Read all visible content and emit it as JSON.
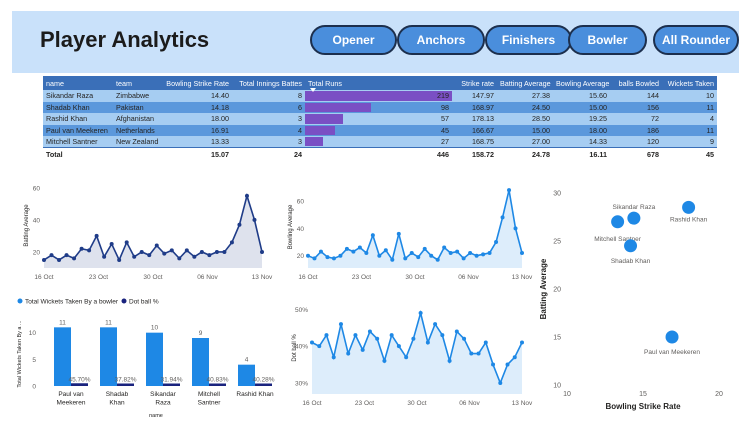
{
  "header": {
    "title": "Player Analytics",
    "buttons": [
      "Opener",
      "Anchors",
      "Finishers",
      "Bowler",
      "All Rounder"
    ]
  },
  "table": {
    "columns": [
      "name",
      "team",
      "Bowling Strike Rate",
      "Total Innings Battes",
      "Total Runs",
      "Strike rate",
      "Batting Average",
      "Bowling Average",
      "balls Bowled",
      "Wickets Taken"
    ],
    "rows": [
      [
        "Sikandar Raza",
        "Zimbabwe",
        "14.40",
        "8",
        "219",
        "147.97",
        "27.38",
        "15.60",
        "144",
        "10"
      ],
      [
        "Shadab Khan",
        "Pakistan",
        "14.18",
        "6",
        "98",
        "168.97",
        "24.50",
        "15.00",
        "156",
        "11"
      ],
      [
        "Rashid Khan",
        "Afghanistan",
        "18.00",
        "3",
        "57",
        "178.13",
        "28.50",
        "19.25",
        "72",
        "4"
      ],
      [
        "Paul van Meekeren",
        "Netherlands",
        "16.91",
        "4",
        "45",
        "166.67",
        "15.00",
        "18.00",
        "186",
        "11"
      ],
      [
        "Mitchell Santner",
        "New Zealand",
        "13.33",
        "3",
        "27",
        "168.75",
        "27.00",
        "14.33",
        "120",
        "9"
      ]
    ],
    "total": [
      "Total",
      "",
      "15.07",
      "24",
      "446",
      "158.72",
      "24.78",
      "16.11",
      "678",
      "45"
    ],
    "bar_color": "#7a4fc4"
  },
  "chart_data": [
    {
      "type": "area",
      "ylabel": "Batting Average",
      "xticks": [
        "16 Oct",
        "23 Oct",
        "30 Oct",
        "06 Nov",
        "13 Nov"
      ],
      "yticks": [
        "20",
        "40",
        "60"
      ],
      "ylim": [
        10,
        63
      ],
      "color": "#1f3c88",
      "values": [
        15,
        18,
        15,
        18,
        16,
        22,
        21,
        30,
        17,
        25,
        15,
        26,
        17,
        20,
        18,
        24,
        19,
        21,
        16,
        21,
        17,
        20,
        18,
        20,
        20,
        26,
        37,
        55,
        40,
        20
      ]
    },
    {
      "type": "area",
      "ylabel": "Bowling Average",
      "xticks": [
        "16 Oct",
        "23 Oct",
        "30 Oct",
        "06 Nov",
        "13 Nov"
      ],
      "yticks": [
        "20",
        "40",
        "60"
      ],
      "ylim": [
        11,
        71
      ],
      "color": "#1e88e5",
      "values": [
        20,
        18,
        23,
        19,
        18,
        20,
        25,
        23,
        26,
        22,
        35,
        20,
        24,
        17,
        36,
        18,
        22,
        19,
        25,
        20,
        17,
        26,
        22,
        23,
        18,
        22,
        20,
        21,
        22,
        30,
        48,
        68,
        40,
        22
      ]
    },
    {
      "type": "bar",
      "legend": [
        "Total Wickets Taken By a bowler",
        "Dot ball %"
      ],
      "ylabel": "Total Wickets Taken By a ...",
      "xlabel": "name",
      "categories": [
        "Paul van Meekeren",
        "Shadab Khan",
        "Sikandar Raza",
        "Mitchell Santner",
        "Rashid Khan"
      ],
      "category_lines": [
        [
          "Paul van",
          "Meekeren"
        ],
        [
          "Shadab",
          "Khan"
        ],
        [
          "Sikandar",
          "Raza"
        ],
        [
          "Mitchell",
          "Santner"
        ],
        [
          "Rashid Khan"
        ]
      ],
      "series": [
        {
          "name": "Total Wickets Taken By a bowler",
          "values": [
            11,
            11,
            10,
            9,
            4
          ],
          "color": "#1e88e5"
        },
        {
          "name": "Dot ball %",
          "values": [
            0.457,
            0.3782,
            0.3194,
            0.4083,
            0.4028
          ],
          "labels": [
            "45.70%",
            "37.82%",
            "31.94%",
            "40.83%",
            "40.28%"
          ],
          "color": "#1a237e"
        }
      ],
      "yticks": [
        "0",
        "5",
        "10"
      ],
      "ylim": [
        0,
        12
      ]
    },
    {
      "type": "area",
      "ylabel": "Dot ball %",
      "xticks": [
        "16 Oct",
        "23 Oct",
        "30 Oct",
        "06 Nov",
        "13 Nov"
      ],
      "yticks": [
        "30%",
        "40%",
        "50%"
      ],
      "ylim": [
        0.27,
        0.52
      ],
      "color": "#1e88e5",
      "values": [
        0.41,
        0.4,
        0.43,
        0.37,
        0.46,
        0.38,
        0.43,
        0.39,
        0.44,
        0.42,
        0.36,
        0.43,
        0.4,
        0.37,
        0.42,
        0.49,
        0.41,
        0.46,
        0.43,
        0.36,
        0.44,
        0.42,
        0.38,
        0.38,
        0.41,
        0.35,
        0.3,
        0.35,
        0.37,
        0.41
      ]
    },
    {
      "type": "scatter",
      "xlabel": "Bowling Strike Rate",
      "ylabel": "Batting Average",
      "xlim": [
        10,
        20
      ],
      "ylim": [
        10,
        30
      ],
      "xticks": [
        "10",
        "15",
        "20"
      ],
      "yticks": [
        "10",
        "15",
        "20",
        "25",
        "30"
      ],
      "color": "#1e88e5",
      "points": [
        {
          "label": "Sikandar Raza",
          "x": 14.4,
          "y": 27.38
        },
        {
          "label": "Mitchell Santner",
          "x": 13.33,
          "y": 27.0
        },
        {
          "label": "Rashid Khan",
          "x": 18.0,
          "y": 28.5
        },
        {
          "label": "Shadab Khan",
          "x": 14.18,
          "y": 24.5
        },
        {
          "label": "Paul van Meekeren",
          "x": 16.91,
          "y": 15.0
        }
      ]
    }
  ]
}
